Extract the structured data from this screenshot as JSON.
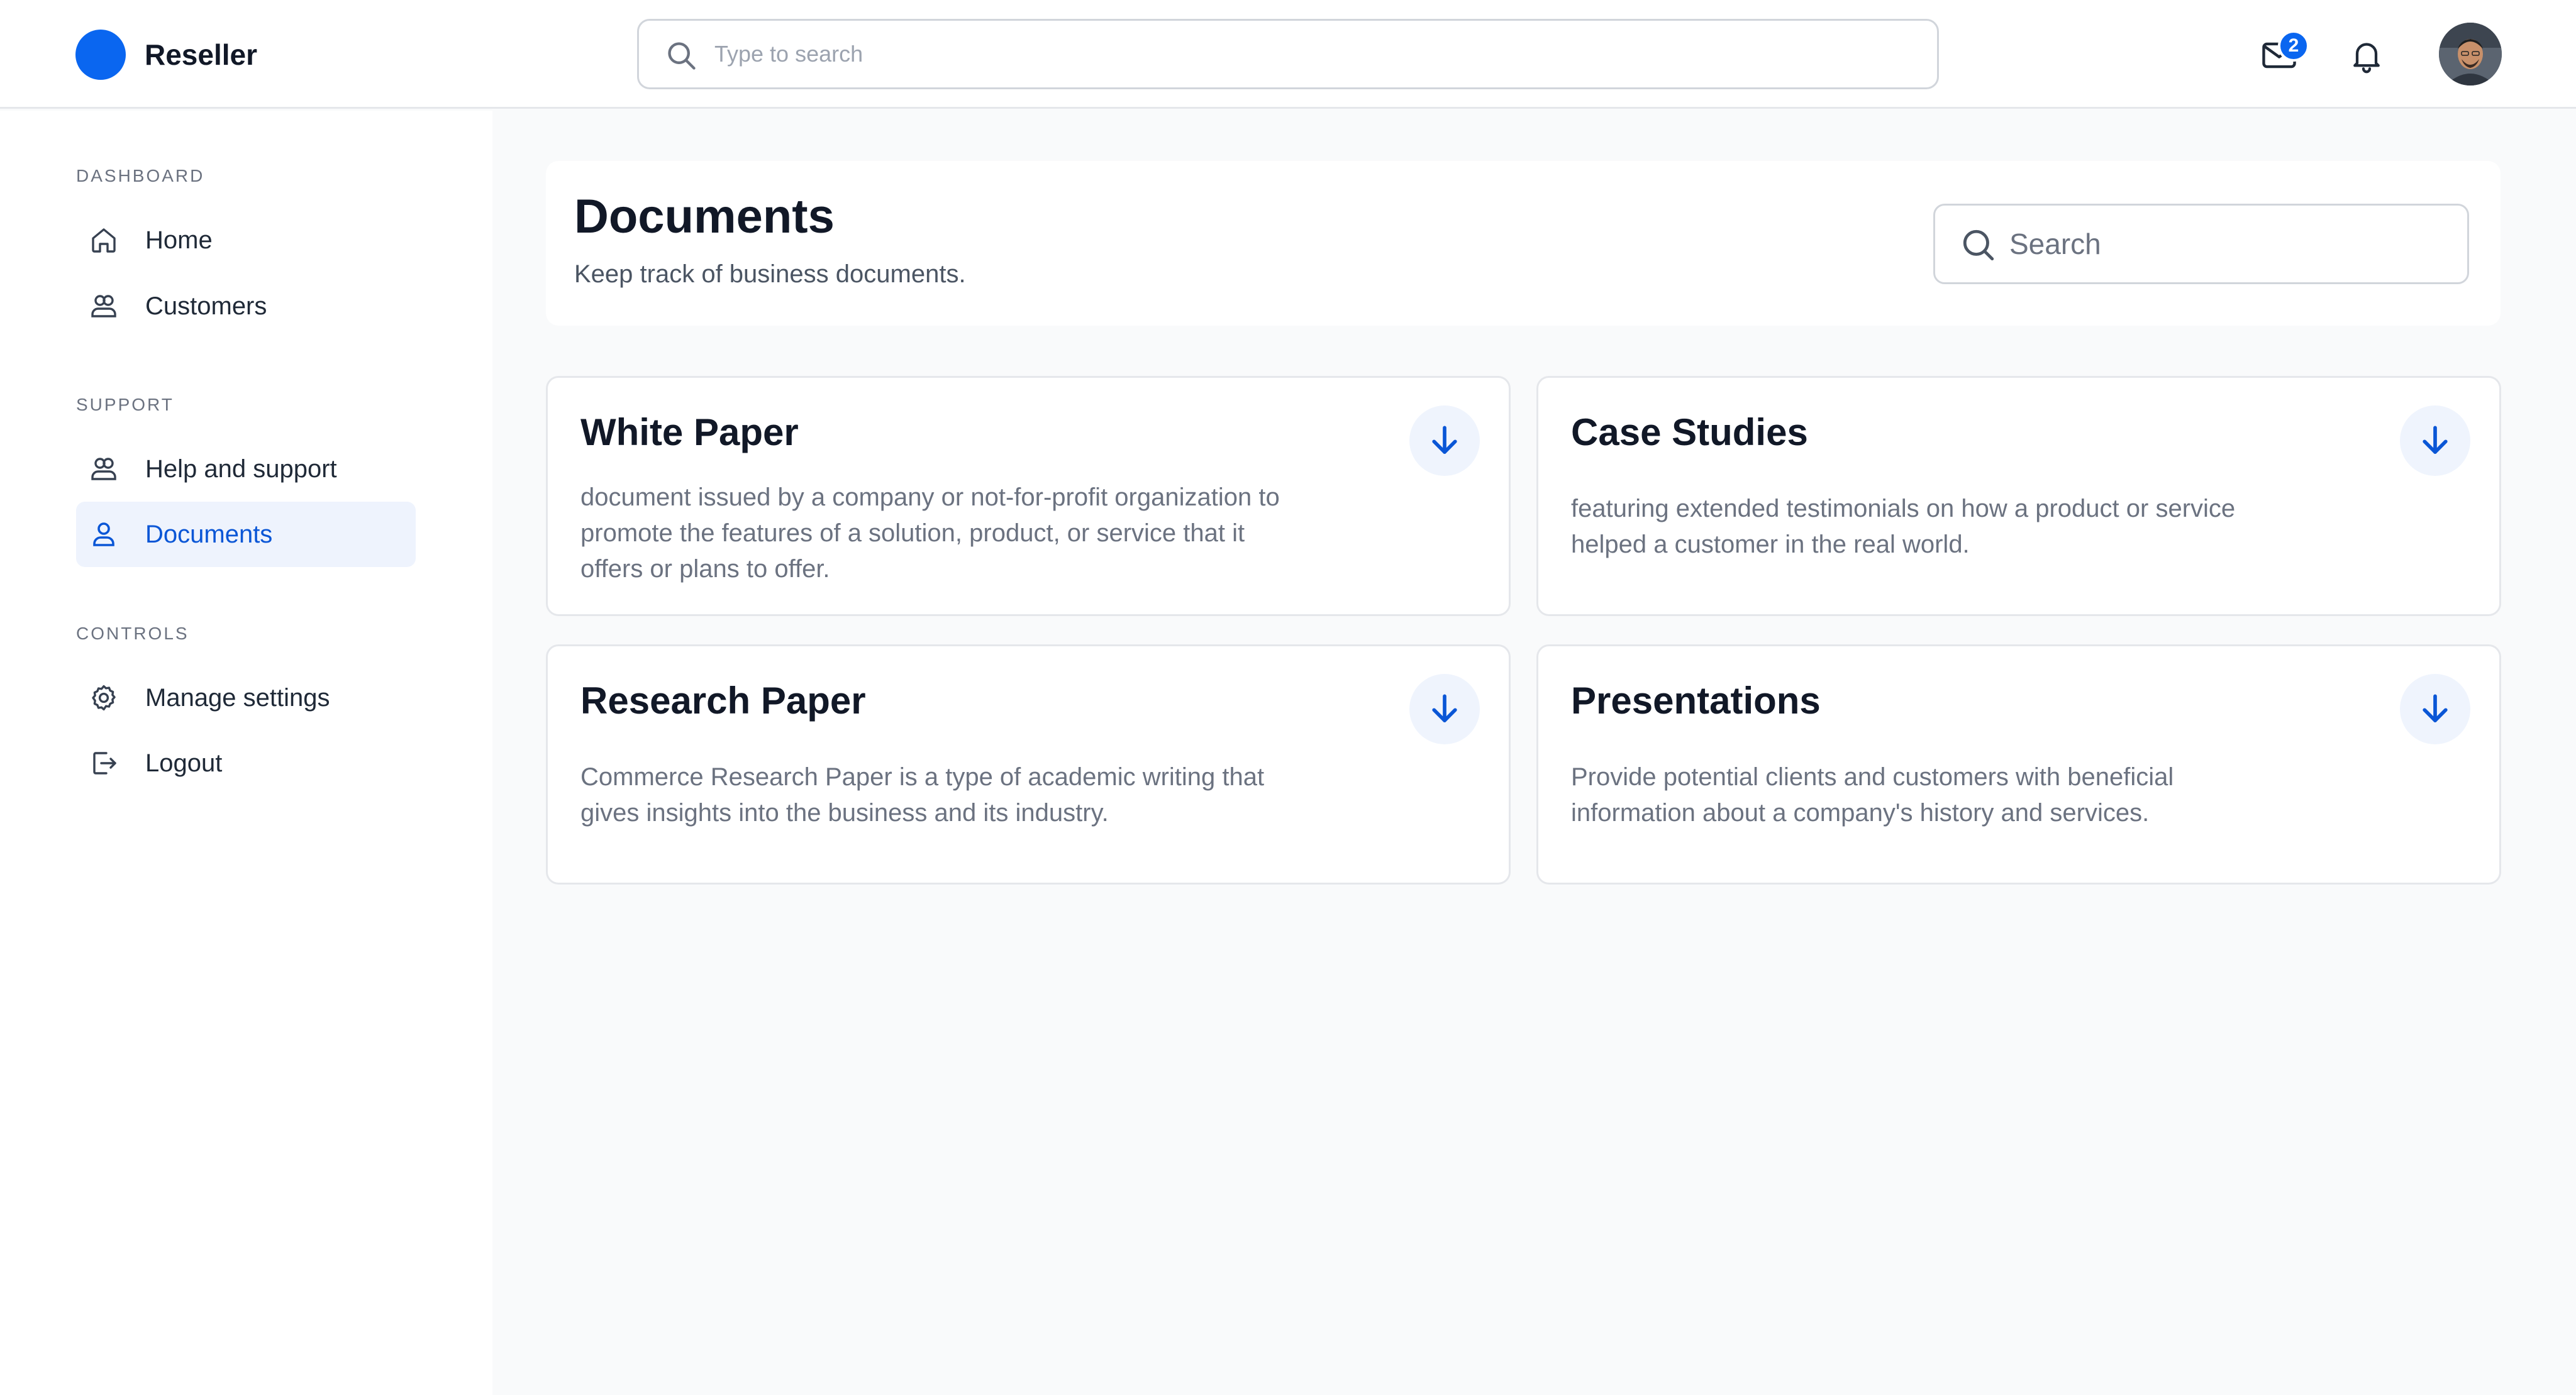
{
  "app": {
    "brand_name": "Reseller",
    "brand_color": "#0a66f0",
    "accent_color": "#0a56d6"
  },
  "topbar": {
    "search_placeholder": "Type to search",
    "search_icon": "search-icon",
    "mail_icon": "mail-icon",
    "mail_badge_count": "2",
    "notifications_icon": "bell-icon",
    "avatar": "user-avatar"
  },
  "sidebar": {
    "sections": [
      {
        "title": "DASHBOARD",
        "items": [
          {
            "label": "Home",
            "icon": "home-icon",
            "active": false
          },
          {
            "label": "Customers",
            "icon": "users-icon",
            "active": false
          }
        ]
      },
      {
        "title": "SUPPORT",
        "items": [
          {
            "label": "Help and support",
            "icon": "users-icon",
            "active": false
          },
          {
            "label": "Documents",
            "icon": "user-icon",
            "active": true
          }
        ]
      },
      {
        "title": "CONTROLS",
        "items": [
          {
            "label": "Manage settings",
            "icon": "gear-icon",
            "active": false
          },
          {
            "label": "Logout",
            "icon": "logout-icon",
            "active": false
          }
        ]
      }
    ]
  },
  "main": {
    "title": "Documents",
    "subtitle": "Keep track of business documents.",
    "search_placeholder": "Search",
    "documents": [
      {
        "title": "White Paper",
        "description": "document issued by a company or not-for-profit organization to promote the features of a solution, product, or service that it offers or plans to offer.",
        "action_icon": "download-icon"
      },
      {
        "title": "Case Studies",
        "description": "featuring extended testimonials on how a product or service helped a customer in the real world.",
        "action_icon": "download-icon"
      },
      {
        "title": "Research Paper",
        "description": "Commerce Research Paper is a type of academic writing that gives insights into the business and its industry.",
        "action_icon": "download-icon"
      },
      {
        "title": "Presentations",
        "description": "Provide potential clients and customers with beneficial information about a company's history and services.",
        "action_icon": "download-icon"
      }
    ]
  }
}
